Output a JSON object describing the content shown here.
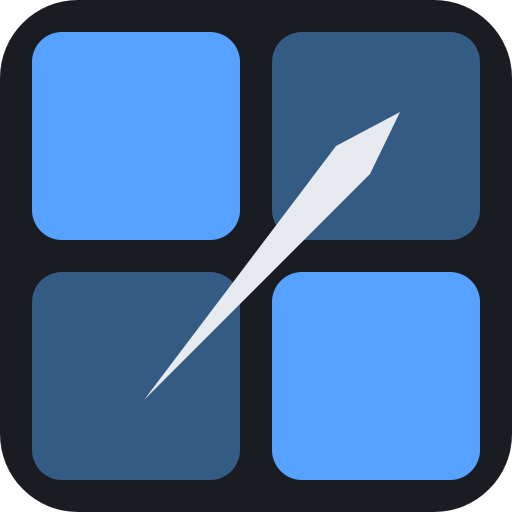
{
  "icon": {
    "name": "grid-pen-app-icon",
    "colors": {
      "background": "#1a1c21",
      "tile_light": "#56a3ff",
      "tile_dark": "#335b83",
      "stroke": "#e7ebf0"
    },
    "tiles": [
      {
        "name": "tile-top-left",
        "tone": "light"
      },
      {
        "name": "tile-top-right",
        "tone": "dark"
      },
      {
        "name": "tile-bottom-left",
        "tone": "dark"
      },
      {
        "name": "tile-bottom-right",
        "tone": "light"
      }
    ],
    "glyph": "pen-stroke-icon"
  }
}
